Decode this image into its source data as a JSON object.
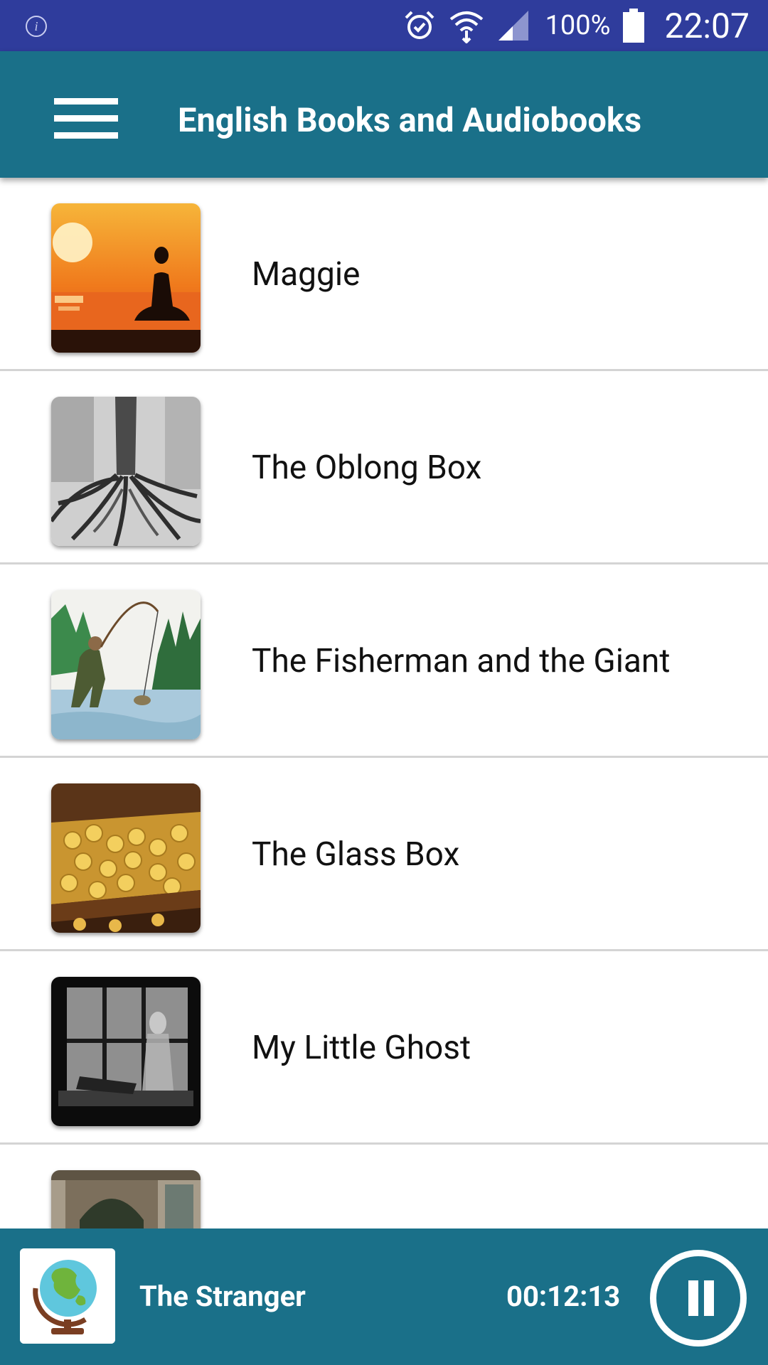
{
  "status_bar": {
    "battery_percent": "100%",
    "time": "22:07",
    "icons": [
      "info-icon",
      "alarm-icon",
      "wifi-icon",
      "signal-icon",
      "battery-icon"
    ]
  },
  "app_bar": {
    "title": "English Books and Audiobooks",
    "menu_icon": "hamburger-menu-icon",
    "color": "#1a7089"
  },
  "books": [
    {
      "title": "Maggie",
      "cover": "sunset-meditation"
    },
    {
      "title": "The Oblong Box",
      "cover": "tree-roots"
    },
    {
      "title": "The Fisherman and the Giant",
      "cover": "fisherman-river"
    },
    {
      "title": "The Glass Box",
      "cover": "treasure-chest"
    },
    {
      "title": "My Little Ghost",
      "cover": "window-ghost"
    },
    {
      "title": "",
      "cover": "building-doorway"
    }
  ],
  "player": {
    "title": "The Stranger",
    "elapsed": "00:12:13",
    "cover": "globe",
    "control_icon": "pause-icon"
  },
  "colors": {
    "status_bar": "#2f3c9c",
    "primary": "#1a7089",
    "divider": "#d4d4d4"
  }
}
